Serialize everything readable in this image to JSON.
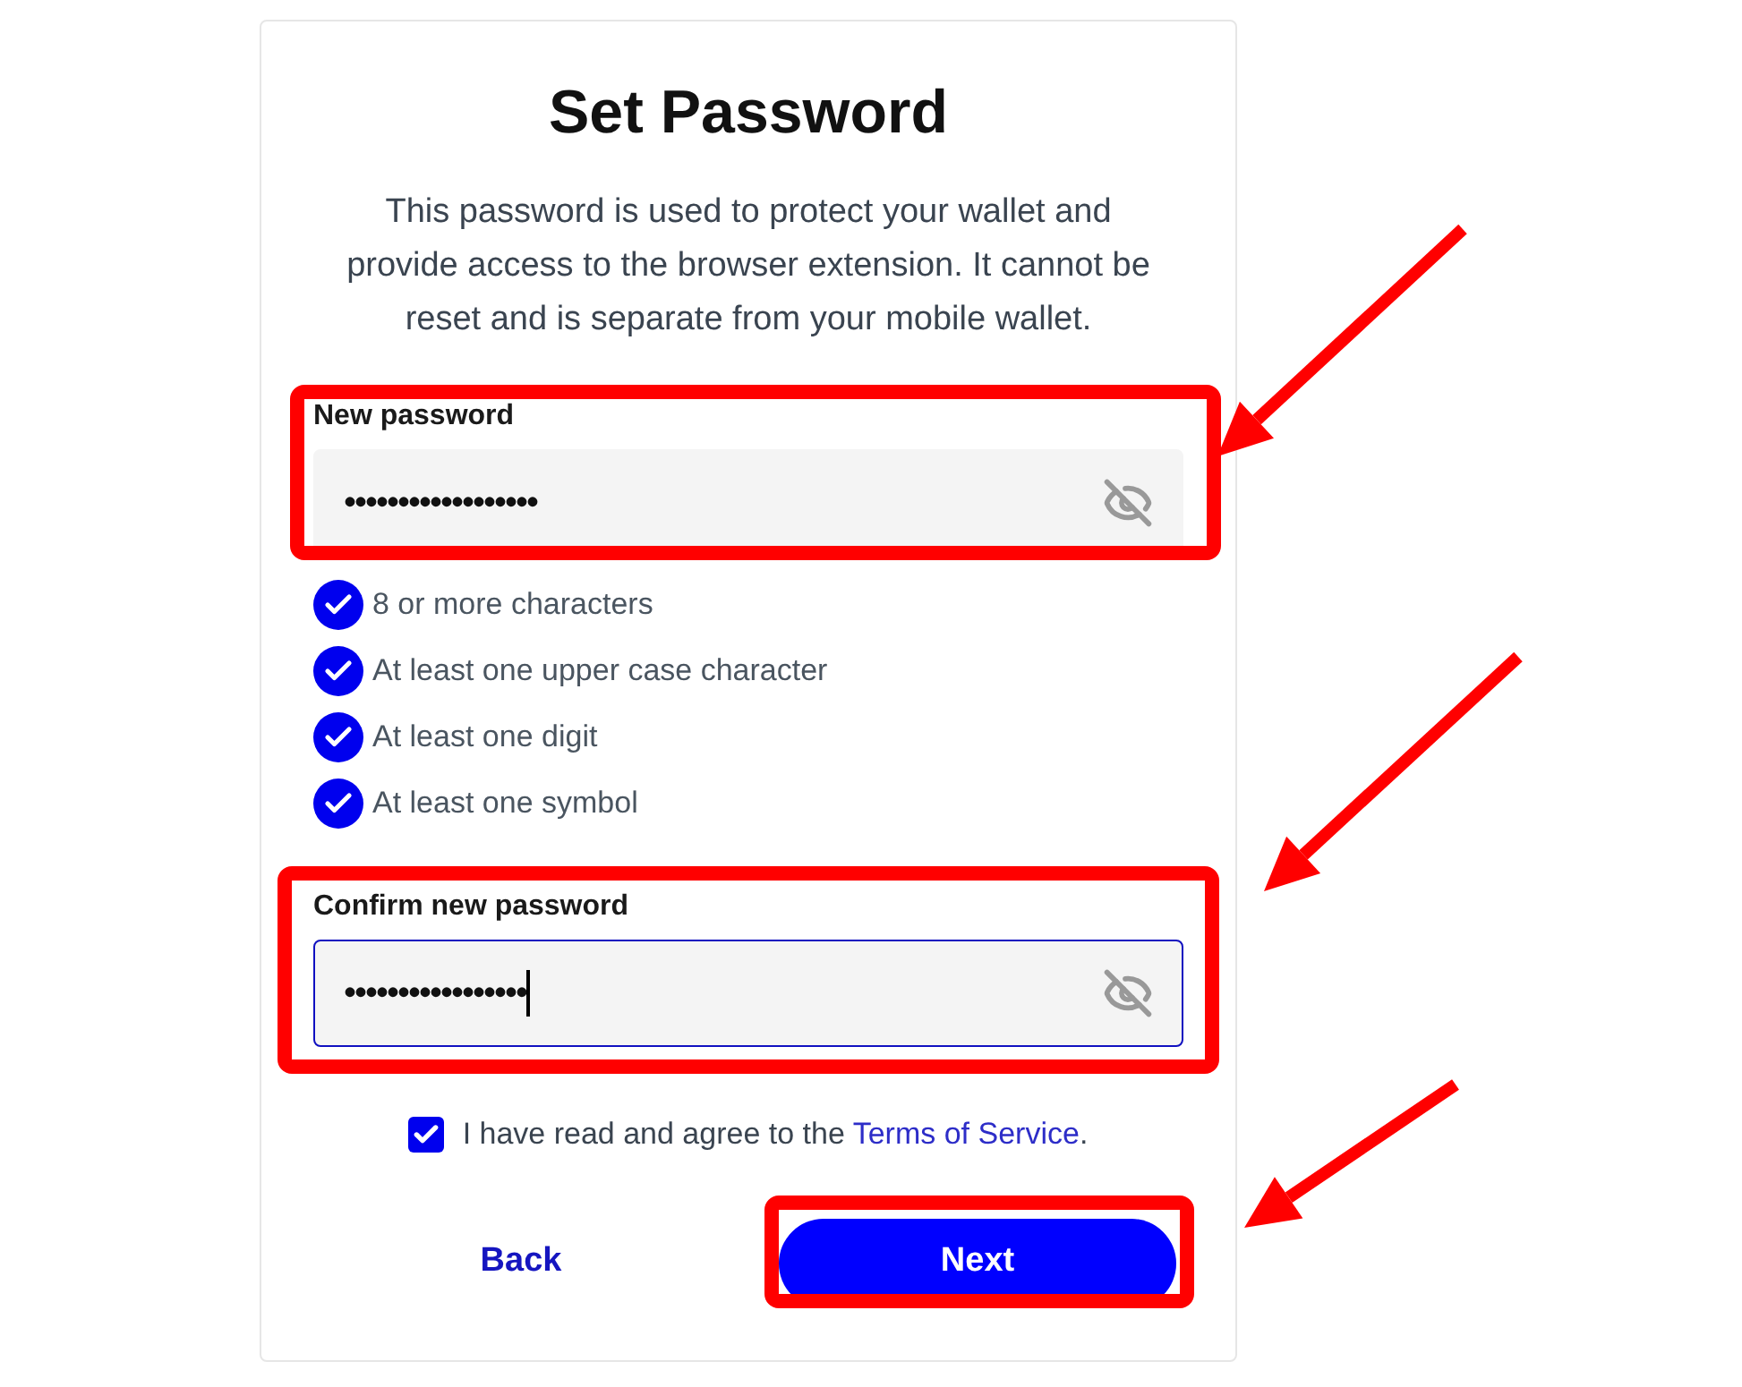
{
  "title": "Set Password",
  "description": "This password is used to protect your wallet and provide access to the browser extension. It cannot be reset and is separate from your mobile wallet.",
  "fields": [
    {
      "label": "New password",
      "value": "••••••••••••••••••",
      "focused": false,
      "caret": false
    },
    {
      "label": "Confirm new password",
      "value": "•••••••••••••••••",
      "focused": true,
      "caret": true
    }
  ],
  "requirements": [
    {
      "label": "8 or more characters",
      "checked": true
    },
    {
      "label": "At least one upper case character",
      "checked": true
    },
    {
      "label": "At least one digit",
      "checked": true
    },
    {
      "label": "At least one symbol",
      "checked": true
    }
  ],
  "terms": {
    "checked": true,
    "text": "I have read and agree to the ",
    "link": "Terms of Service",
    "suffix": "."
  },
  "buttons": {
    "back": "Back",
    "next": "Next"
  }
}
